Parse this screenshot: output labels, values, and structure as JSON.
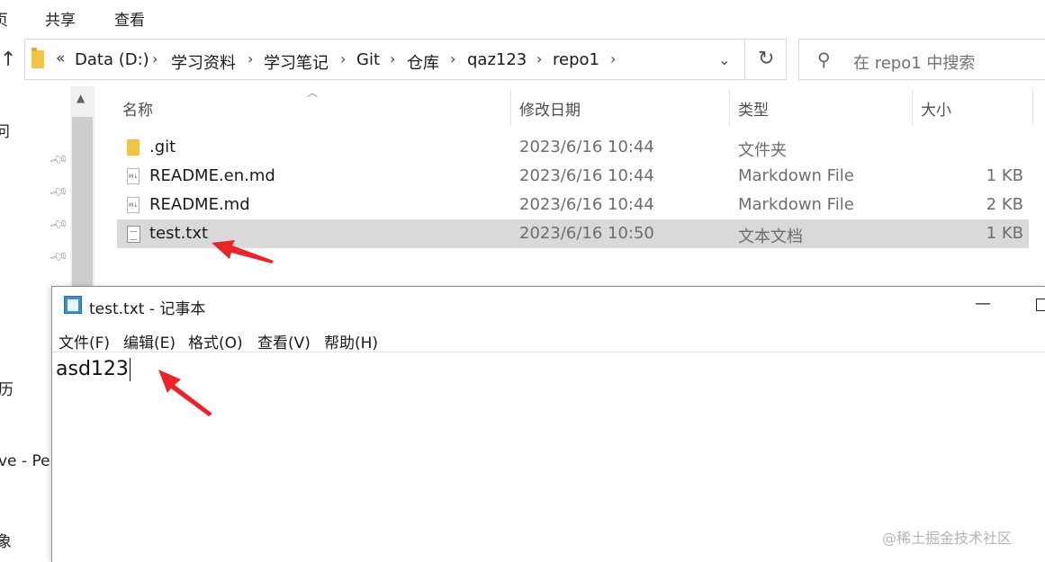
{
  "ribbon": {
    "tab_cut": "页",
    "tab_share": "共享",
    "tab_view": "查看"
  },
  "address": {
    "overflow": "«",
    "crumbs": [
      "Data (D:)",
      "学习资料",
      "学习笔记",
      "Git",
      "仓库",
      "qaz123",
      "repo1"
    ],
    "search_placeholder": "在 repo1 中搜索"
  },
  "nav": {
    "item_1": "问",
    "item_2": "历",
    "item_3": "ve - Per",
    "item_4": "象"
  },
  "columns": {
    "name": "名称",
    "modified": "修改日期",
    "type": "类型",
    "size": "大小"
  },
  "files": [
    {
      "name": ".git",
      "modified": "2023/6/16 10:44",
      "type": "文件夹",
      "size": "",
      "icon": "folder-icon"
    },
    {
      "name": "README.en.md",
      "modified": "2023/6/16 10:44",
      "type": "Markdown File",
      "size": "1 KB",
      "icon": "markdown-file-icon"
    },
    {
      "name": "README.md",
      "modified": "2023/6/16 10:44",
      "type": "Markdown File",
      "size": "2 KB",
      "icon": "markdown-file-icon"
    },
    {
      "name": "test.txt",
      "modified": "2023/6/16 10:50",
      "type": "文本文档",
      "size": "1 KB",
      "icon": "text-file-icon",
      "selected": true
    }
  ],
  "notepad": {
    "title": "test.txt - 记事本",
    "menu": [
      "文件(F)",
      "编辑(E)",
      "格式(O)",
      "查看(V)",
      "帮助(H)"
    ],
    "content": "asd123"
  },
  "watermark": "@稀土掘金技术社区",
  "colors": {
    "selection": "#d9d9d9",
    "annotation_arrow": "#e8262a",
    "folder": "#f3c342"
  }
}
